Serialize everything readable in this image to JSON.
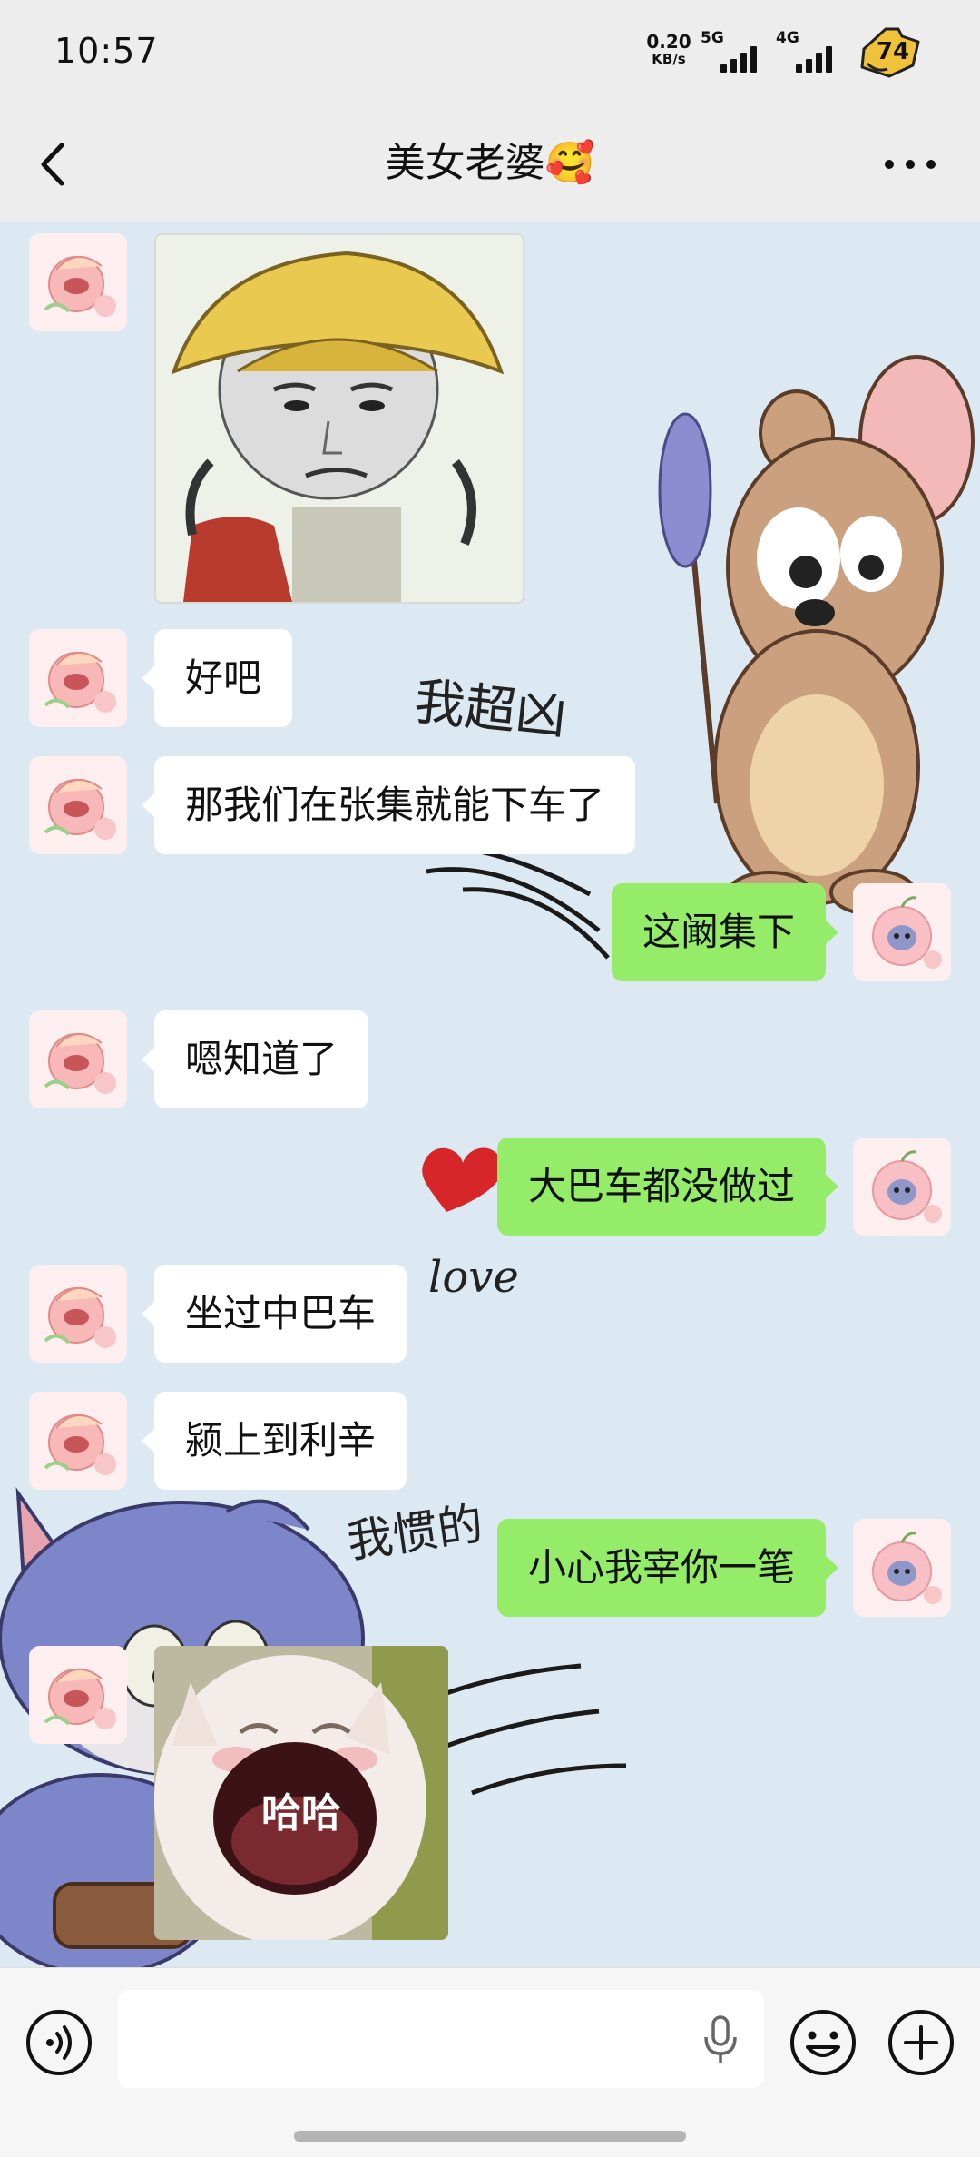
{
  "status_bar": {
    "time": "10:57",
    "net_speed_value": "0.20",
    "net_speed_unit": "KB/s",
    "signal_1_label": "5G",
    "signal_2_label": "4G",
    "battery_level": "74"
  },
  "nav": {
    "title": "美女老婆🥰",
    "back_icon": "chevron-left-icon",
    "more_icon": "more-horizontal-icon"
  },
  "wallpaper_text": {
    "top": "我超凶",
    "middle": "love",
    "bottom": "我惯的"
  },
  "messages": [
    {
      "sender": "contact",
      "kind": "sticker",
      "description_icon": "yellow-hat-kid-sticker"
    },
    {
      "sender": "contact",
      "kind": "text",
      "text": "好吧"
    },
    {
      "sender": "contact",
      "kind": "text",
      "text": "那我们在张集就能下车了"
    },
    {
      "sender": "me",
      "kind": "text",
      "text": "这阚集下"
    },
    {
      "sender": "contact",
      "kind": "text",
      "text": "嗯知道了"
    },
    {
      "sender": "me",
      "kind": "text",
      "text": "大巴车都没做过"
    },
    {
      "sender": "contact",
      "kind": "text",
      "text": "坐过中巴车"
    },
    {
      "sender": "contact",
      "kind": "text",
      "text": "颍上到利辛"
    },
    {
      "sender": "me",
      "kind": "text",
      "text": "小心我宰你一笔"
    },
    {
      "sender": "contact",
      "kind": "sticker",
      "caption": "哈哈"
    }
  ],
  "input_bar": {
    "placeholder": "",
    "voice_icon": "voice-mode-icon",
    "mic_icon": "microphone-icon",
    "emoji_icon": "emoji-icon",
    "plus_icon": "plus-circle-icon"
  },
  "colors": {
    "outgoing_bubble": "#95ec69",
    "incoming_bubble": "#ffffff",
    "chat_background": "#dce9f3",
    "bar_background": "#ededed"
  }
}
